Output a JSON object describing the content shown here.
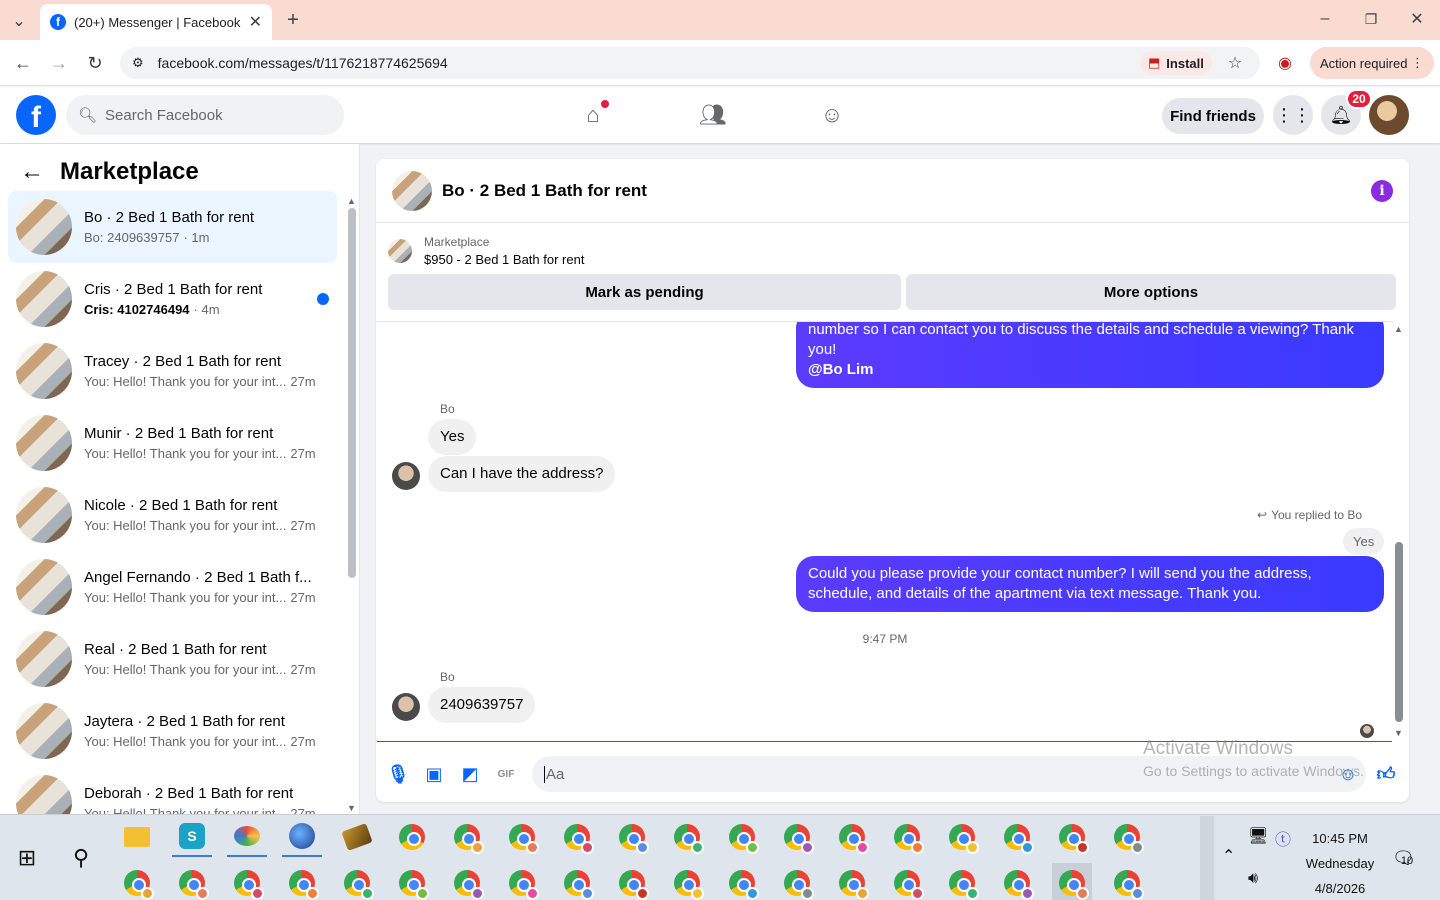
{
  "browser": {
    "tab_title": "(20+) Messenger | Facebook",
    "new_tab": "+",
    "url": "facebook.com/messages/t/1176218774625694",
    "install_label": "Install",
    "action_required": "Action required"
  },
  "fb": {
    "logo": "f",
    "search_placeholder": "Search Facebook",
    "find_friends": "Find friends",
    "notif_count": "20"
  },
  "sidebar": {
    "title": "Marketplace",
    "conversations": [
      {
        "title": "Bo · 2 Bed 1 Bath for rent",
        "preview": "Bo: 2409639757",
        "time": "· 1m",
        "active": true,
        "unread": false
      },
      {
        "title": "Cris · 2 Bed 1 Bath for rent",
        "preview": "Cris: 4102746494",
        "time": "· 4m",
        "active": false,
        "unread": true
      },
      {
        "title": "Tracey · 2 Bed 1 Bath for rent",
        "preview": "You: Hello! Thank you for your int...",
        "time": "27m"
      },
      {
        "title": "Munir · 2 Bed 1 Bath for rent",
        "preview": "You: Hello! Thank you for your int...",
        "time": "27m"
      },
      {
        "title": "Nicole · 2 Bed 1 Bath for rent",
        "preview": "You: Hello! Thank you for your int...",
        "time": "27m"
      },
      {
        "title": "Angel Fernando · 2 Bed 1 Bath f...",
        "preview": "You: Hello! Thank you for your int...",
        "time": "27m"
      },
      {
        "title": "Real · 2 Bed 1 Bath for rent",
        "preview": "You: Hello! Thank you for your int...",
        "time": "27m"
      },
      {
        "title": "Jaytera · 2 Bed 1 Bath for rent",
        "preview": "You: Hello! Thank you for your int...",
        "time": "27m"
      },
      {
        "title": "Deborah · 2 Bed 1 Bath for rent",
        "preview": "You: Hello! Thank you for your int...",
        "time": "27m"
      }
    ]
  },
  "chat": {
    "title": "Bo · 2 Bed 1 Bath for rent",
    "listing_label": "Marketplace",
    "listing_title": "$950 - 2 Bed 1 Bath for rent",
    "mark_pending": "Mark as pending",
    "more_options": "More options",
    "messages": {
      "out1": "number so I can contact you to discuss the details and schedule a viewing? Thank you!",
      "out1_mention": "@Bo Lim",
      "sender1": "Bo",
      "in1": "Yes",
      "in2": "Can I have the address?",
      "replied_to": "You replied to Bo",
      "quoted": "Yes",
      "out2": "Could you please provide your contact number? I will send you the address, schedule, and details of the apartment via text message. Thank you.",
      "timestamp": "9:47 PM",
      "sender2": "Bo",
      "in3": "2409639757"
    },
    "composer_placeholder": "Aa"
  },
  "watermark": {
    "line1": "Activate Windows",
    "line2": "Go to Settings to activate Windows."
  },
  "taskbar": {
    "time": "10:45 PM",
    "day": "Wednesday",
    "date": "4/8/2026",
    "notifications": "10"
  }
}
